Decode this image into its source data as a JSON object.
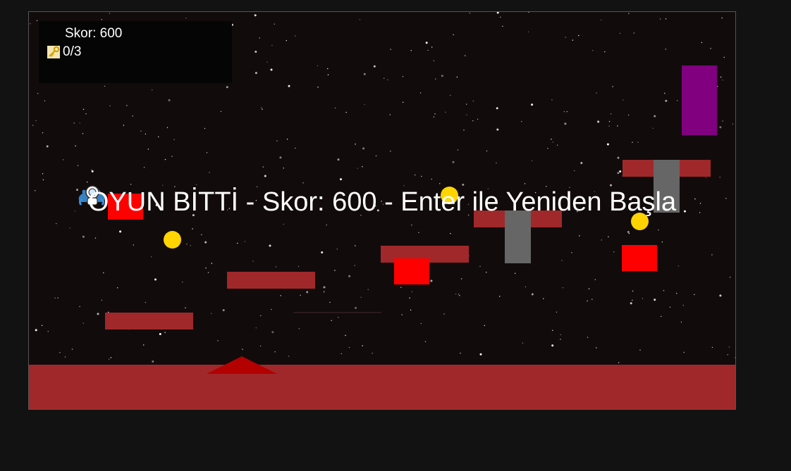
{
  "hud": {
    "score_text": "Skor: 600",
    "keys_text": "0/3",
    "key_icon": "key-icon"
  },
  "game_over": {
    "message": "OYUN BİTTİ - Skor: 600 - Enter ile Yeniden Başla"
  },
  "colors": {
    "background": "#120b0c",
    "platform": "#a0282a",
    "enemy": "#ff0000",
    "pillar": "#666666",
    "coin": "#ffd400",
    "door": "#800080",
    "spike": "#b30000"
  }
}
